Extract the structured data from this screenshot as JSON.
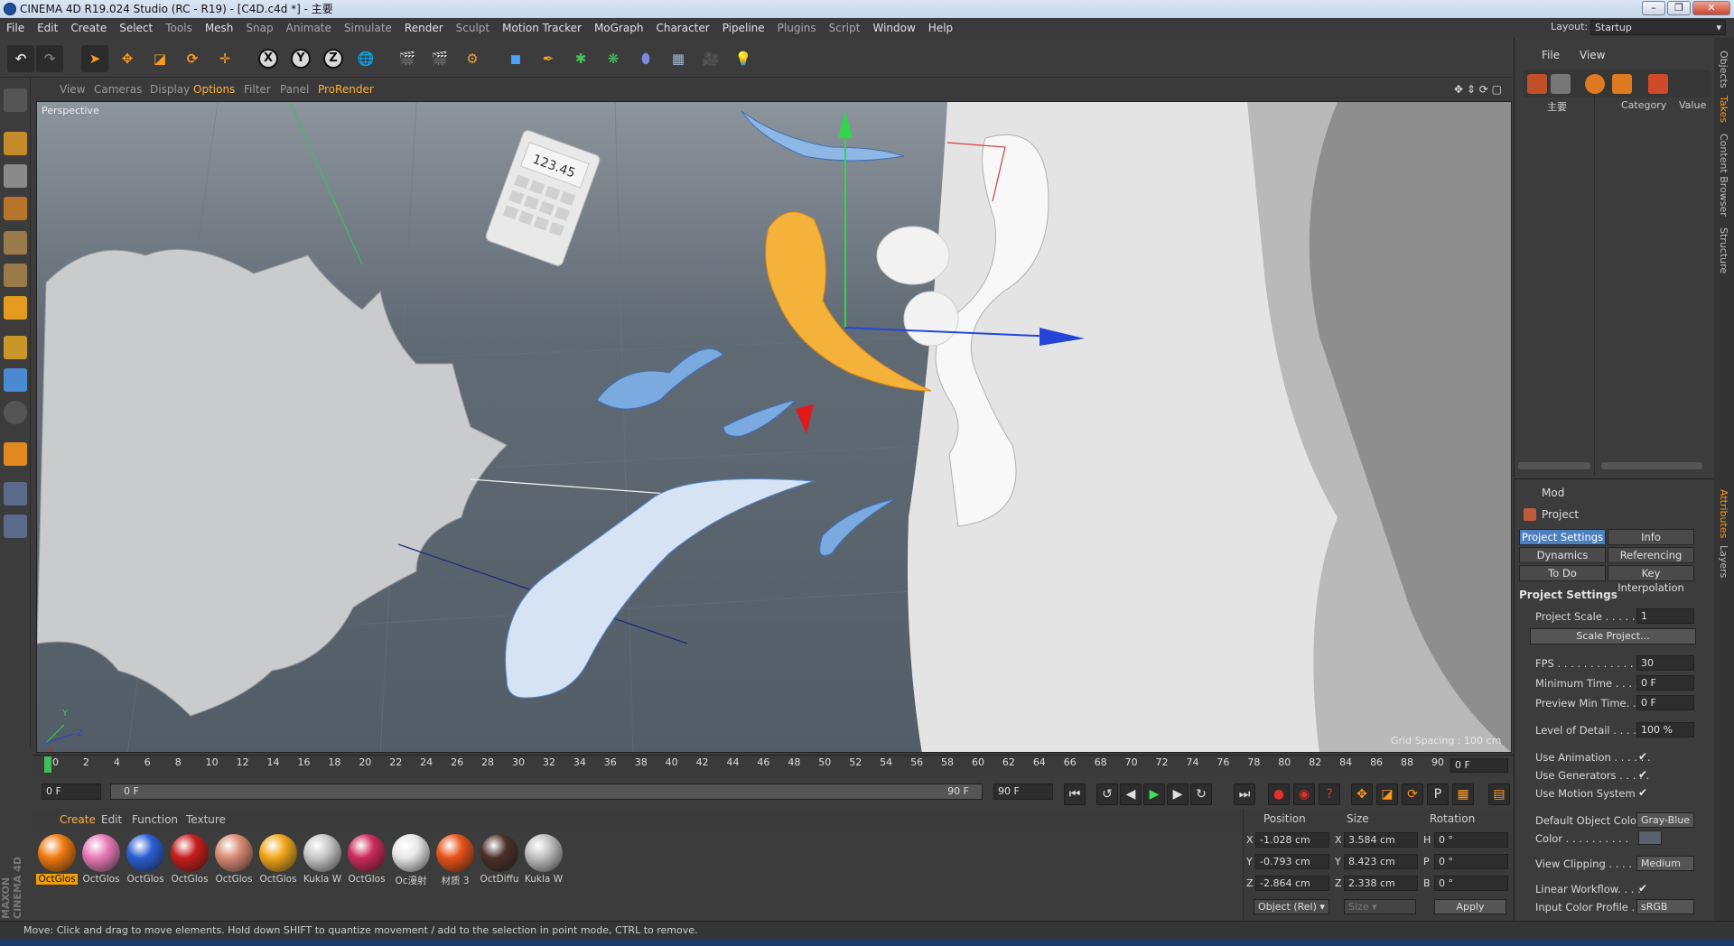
{
  "window": {
    "title": "CINEMA 4D R19.024 Studio (RC - R19) - [C4D.c4d *] - 主要"
  },
  "menu": [
    "File",
    "Edit",
    "Create",
    "Select",
    "Tools",
    "Mesh",
    "Snap",
    "Animate",
    "Simulate",
    "Render",
    "Sculpt",
    "Motion Tracker",
    "MoGraph",
    "Character",
    "Pipeline",
    "Plugins",
    "Script",
    "Window",
    "Help"
  ],
  "layout": {
    "label": "Layout:",
    "value": "Startup"
  },
  "viewport_menu": [
    "View",
    "Cameras",
    "Display",
    "Options",
    "Filter",
    "Panel",
    "ProRender"
  ],
  "viewport": {
    "camera_label": "Perspective",
    "grid_spacing": "Grid Spacing : 100 cm",
    "calculator_display": "123.45"
  },
  "timeline": {
    "ticks": [
      "0",
      "2",
      "4",
      "6",
      "8",
      "10",
      "12",
      "14",
      "16",
      "18",
      "20",
      "22",
      "24",
      "26",
      "28",
      "30",
      "32",
      "34",
      "36",
      "38",
      "40",
      "42",
      "44",
      "46",
      "48",
      "50",
      "52",
      "54",
      "56",
      "58",
      "60",
      "62",
      "64",
      "66",
      "68",
      "70",
      "72",
      "74",
      "76",
      "78",
      "80",
      "82",
      "84",
      "86",
      "88",
      "90"
    ],
    "current_frame": "0 F",
    "start_field": "0 F",
    "range_start": "0 F",
    "range_end": "90 F",
    "end_field": "90 F"
  },
  "material_menu": [
    "Create",
    "Edit",
    "Function",
    "Texture"
  ],
  "materials": [
    {
      "label": "OctGlos",
      "color": "#f07a10"
    },
    {
      "label": "OctGlos",
      "color": "#e87ab8"
    },
    {
      "label": "OctGlos",
      "color": "#2c5fd4"
    },
    {
      "label": "OctGlos",
      "color": "#c81d1d"
    },
    {
      "label": "OctGlos",
      "color": "#d88a74"
    },
    {
      "label": "OctGlos",
      "color": "#f0a71a"
    },
    {
      "label": "Kukla W",
      "color": "#c8c8c8"
    },
    {
      "label": "OctGlos",
      "color": "#cc2a5c"
    },
    {
      "label": "Oc漫射",
      "color": "#e8e8e8"
    },
    {
      "label": "材质 3",
      "color": "#e8521a"
    },
    {
      "label": "OctDiffu",
      "color": "#4a3028"
    },
    {
      "label": "Kukla W",
      "color": "#c0c0c0"
    }
  ],
  "coords": {
    "headers": [
      "Position",
      "Size",
      "Rotation"
    ],
    "rows": [
      {
        "axis": "X",
        "pos": "-1.028 cm",
        "size_axis": "X",
        "size": "3.584 cm",
        "rot_axis": "H",
        "rot": "0 °"
      },
      {
        "axis": "Y",
        "pos": "-0.793 cm",
        "size_axis": "Y",
        "size": "8.423 cm",
        "rot_axis": "P",
        "rot": "0 °"
      },
      {
        "axis": "Z",
        "pos": "-2.864 cm",
        "size_axis": "Z",
        "size": "2.338 cm",
        "rot_axis": "B",
        "rot": "0 °"
      }
    ],
    "mode": "Object (Rel)",
    "size_mode": "Size",
    "apply": "Apply"
  },
  "status": "Move: Click and drag to move elements. Hold down SHIFT to quantize movement / add to the selection in point mode, CTRL to remove.",
  "objects_panel": {
    "menu": [
      "File",
      "View"
    ],
    "root_name": "主要",
    "col_category": "Category",
    "col_value": "Value"
  },
  "attributes": {
    "menu": "Mod",
    "object": "Project",
    "tabs": [
      "Project Settings",
      "Info",
      "Dynamics",
      "Referencing",
      "To Do",
      "Key Interpolation"
    ],
    "section": "Project Settings",
    "rows": [
      {
        "label": "Project Scale . . . . . .",
        "value": "1"
      },
      {
        "label": "FPS . . . . . . . . . . . . . .",
        "value": "30"
      },
      {
        "label": "Minimum Time . . . .",
        "value": "0 F"
      },
      {
        "label": "Preview Min Time. . .",
        "value": "0 F"
      },
      {
        "label": "Level of Detail . . . . .",
        "value": "100 %"
      }
    ],
    "scale_button": "Scale Project...",
    "checks": [
      "Use Animation . . . . . .",
      "Use Generators . . . . .",
      "Use Motion System"
    ],
    "default_color_label": "Default Object Color",
    "default_color_value": "Gray-Blue",
    "color_label": "Color . . . . . . . . . .",
    "view_clipping_label": "View Clipping . . . . . .",
    "view_clipping_value": "Medium",
    "linear_label": "Linear Workflow. . . .",
    "icp_label": "Input Color Profile . .",
    "icp_value": "sRGB"
  },
  "side_tabs": [
    "Objects",
    "Takes",
    "Content Browser",
    "Structure",
    "Attributes",
    "Layers"
  ]
}
